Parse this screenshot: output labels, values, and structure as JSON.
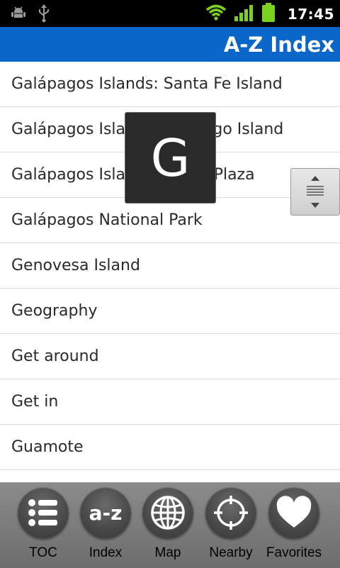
{
  "status_bar": {
    "time": "17:45",
    "icons": [
      "android-debug-icon",
      "usb-icon",
      "wifi-icon",
      "signal-icon",
      "battery-icon"
    ]
  },
  "header": {
    "title": "A-Z Index"
  },
  "list": {
    "items": [
      "Galápagos Islands: Santa Fe Island",
      "Galápagos Islands: Santiago Island",
      "Galápagos Islands: South Plaza",
      "Galápagos National Park",
      "Genovesa Island",
      "Geography",
      "Get around",
      "Get in",
      "Guamote",
      ""
    ]
  },
  "index_overlay": {
    "letter": "G"
  },
  "bottom_nav": {
    "items": [
      {
        "label": "TOC",
        "icon": "list-icon"
      },
      {
        "label": "Index",
        "icon": "a-z-icon",
        "icon_text": "a-z"
      },
      {
        "label": "Map",
        "icon": "globe-icon"
      },
      {
        "label": "Nearby",
        "icon": "crosshair-icon"
      },
      {
        "label": "Favorites",
        "icon": "heart-icon"
      }
    ]
  },
  "colors": {
    "title_bar": "#0a66c8",
    "status_bar": "#000000",
    "accent_green": "#7bd21e"
  }
}
